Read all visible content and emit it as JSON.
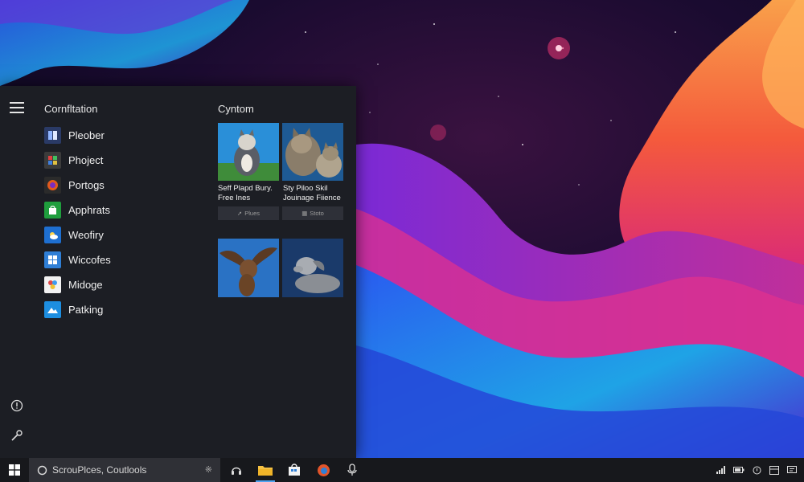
{
  "start_menu": {
    "left_title": "Cornfltation",
    "right_title": "Cyntom",
    "apps": [
      {
        "label": "Pleober",
        "icon": "book-icon",
        "color": "#2a3a66"
      },
      {
        "label": "Phoject",
        "icon": "grid-icon",
        "color": "#3b3b3b"
      },
      {
        "label": "Portogs",
        "icon": "firefox-icon",
        "color": "#e25a1c"
      },
      {
        "label": "Apphrats",
        "icon": "store-bag-icon",
        "color": "#1f9e3d"
      },
      {
        "label": "Weofiry",
        "icon": "weather-icon",
        "color": "#1e6fd0"
      },
      {
        "label": "Wiccofes",
        "icon": "windows-icon",
        "color": "#2f7fd6"
      },
      {
        "label": "Midoge",
        "icon": "photos-icon",
        "color": "#f2f2f2"
      },
      {
        "label": "Patking",
        "icon": "mountain-icon",
        "color": "#1d8ee0"
      }
    ],
    "tiles": [
      {
        "caption_line1": "Seff Plapd Bury.",
        "caption_line2": "Free Ines",
        "button": "Plues",
        "image": "cat-on-blue"
      },
      {
        "caption_line1": "Sty Piloo Skil",
        "caption_line2": "Jouinage Fiience",
        "button": "Stoto",
        "image": "tabby-cats"
      },
      {
        "caption_line1": "",
        "caption_line2": "",
        "button": "",
        "image": "flying-dog"
      },
      {
        "caption_line1": "",
        "caption_line2": "",
        "button": "",
        "image": "lying-dog"
      }
    ]
  },
  "taskbar": {
    "search_text": "ScrouPlces, Coutlools",
    "pinned": [
      "headset-icon",
      "file-explorer-icon",
      "store-icon",
      "edge-icon",
      "microphone-icon"
    ],
    "tray": [
      "signal-icon",
      "battery-icon",
      "info-icon",
      "grid-icon",
      "message-icon"
    ]
  },
  "colors": {
    "accent": "#2f7fd6",
    "menu_bg": "#1c1e24",
    "taskbar_bg": "#17181c"
  }
}
